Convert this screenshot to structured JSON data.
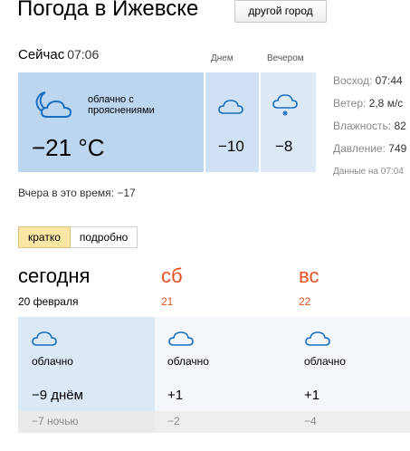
{
  "header": {
    "title": "Погода в Ижевске",
    "change_city_button": "другой город"
  },
  "now": {
    "label": "Сейчас",
    "time": "07:06",
    "condition": "облачно с прояснениями",
    "temperature": "−21 °C",
    "icon": "moon-cloud-icon"
  },
  "day_parts": [
    {
      "label": "Днем",
      "temperature": "−10",
      "icon": "cloud-icon"
    },
    {
      "label": "Вечером",
      "temperature": "−8",
      "icon": "cloud-snow-icon"
    }
  ],
  "details": [
    {
      "label": "Восход:",
      "value": "07:44"
    },
    {
      "label": "Ветер:",
      "value": "2,8 м/с"
    },
    {
      "label": "Влажность:",
      "value": "82"
    },
    {
      "label": "Давление:",
      "value": "749"
    }
  ],
  "data_time_note": "Данные на 07:04",
  "yesterday": {
    "label": "Вчера в это время:",
    "value": "−17"
  },
  "tabs": [
    {
      "label": "кратко",
      "active": true
    },
    {
      "label": "подробно",
      "active": false
    }
  ],
  "forecast": [
    {
      "day": "сегодня",
      "date": "20 февраля",
      "condition": "облачно",
      "day_temp": "−9 днём",
      "night_temp": "−7 ночью",
      "icon": "cloud-icon",
      "color": "#000000"
    },
    {
      "day": "сб",
      "date": "21",
      "condition": "облачно",
      "day_temp": "+1",
      "night_temp": "−2",
      "icon": "cloud-icon",
      "color": "#e8501f"
    },
    {
      "day": "вс",
      "date": "22",
      "condition": "облачно",
      "day_temp": "+1",
      "night_temp": "−4",
      "icon": "cloud-icon",
      "color": "#e8501f"
    }
  ],
  "colors": {
    "now_box": "#bcd6ef",
    "weekend": "#e8501f",
    "active_tab": "#fbe7a3"
  }
}
